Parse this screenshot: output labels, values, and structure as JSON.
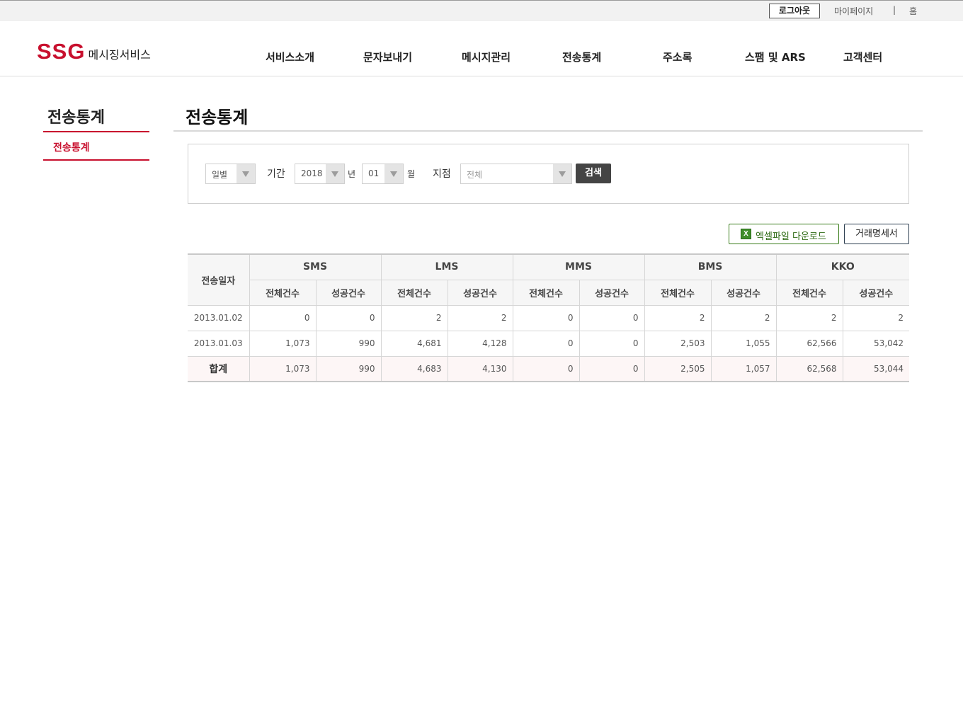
{
  "topbar": {
    "logout": "로그아웃",
    "mypage": "마이페이지",
    "separator": "|",
    "home": "홈"
  },
  "header": {
    "logo_brand": "SSG",
    "logo_service": "메시징서비스",
    "brand_color": "#c8102e",
    "nav": [
      "서비스소개",
      "문자보내기",
      "메시지관리",
      "전송통계",
      "주소록",
      "스팸 및 ARS",
      "고객센터"
    ]
  },
  "lnb": {
    "title": "전송통계",
    "items": [
      "전송통계"
    ]
  },
  "page": {
    "title": "전송통계"
  },
  "search": {
    "period_type": "일별",
    "period_label": "기간",
    "year": "2018",
    "year_unit": "년",
    "month": "01",
    "month_unit": "월",
    "branch_label": "지점",
    "branch": "전체",
    "search_button": "검색"
  },
  "actions": {
    "excel": "엑셀파일 다운로드",
    "excel_icon": "excel-icon",
    "invoice": "거래명세서"
  },
  "table": {
    "date_header": "전송일자",
    "groups": [
      "SMS",
      "LMS",
      "MMS",
      "BMS",
      "KKO"
    ],
    "sub_headers": [
      "전체건수",
      "성공건수"
    ],
    "rows": [
      {
        "date": "2013.01.02",
        "values": [
          "0",
          "0",
          "2",
          "2",
          "0",
          "0",
          "2",
          "2",
          "2",
          "2"
        ]
      },
      {
        "date": "2013.01.03",
        "values": [
          "1,073",
          "990",
          "4,681",
          "4,128",
          "0",
          "0",
          "2,503",
          "1,055",
          "62,566",
          "53,042"
        ]
      }
    ],
    "total": {
      "label": "합계",
      "values": [
        "1,073",
        "990",
        "4,683",
        "4,130",
        "0",
        "0",
        "2,505",
        "1,057",
        "62,568",
        "53,044"
      ]
    }
  }
}
